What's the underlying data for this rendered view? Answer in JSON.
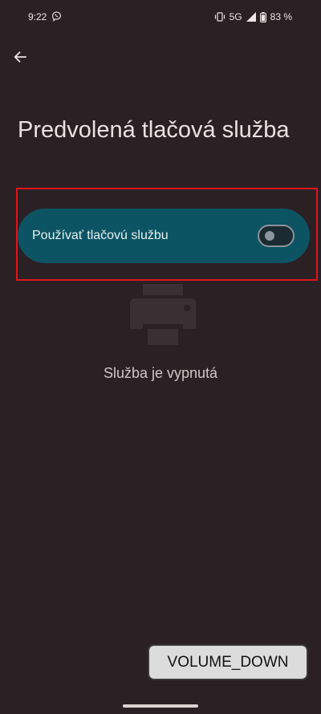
{
  "status_bar": {
    "time": "9:22",
    "app_notification_icon": "viber-icon",
    "vibrate_icon": "vibrate-icon",
    "network": "5G",
    "signal_icon": "signal-icon",
    "battery_icon": "battery-icon",
    "battery": "83 %"
  },
  "toolbar": {
    "back_icon": "arrow-back-icon"
  },
  "page": {
    "title": "Predvolená tlačová služba"
  },
  "toggle": {
    "label": "Používať tlačovú službu",
    "checked": false
  },
  "empty_state": {
    "icon": "printer-icon",
    "text": "Služba je vypnutá"
  },
  "overlay": {
    "key_event": "VOLUME_DOWN"
  },
  "colors": {
    "background": "#2b2124",
    "card": "#0c5463",
    "highlight": "#e0141c"
  }
}
